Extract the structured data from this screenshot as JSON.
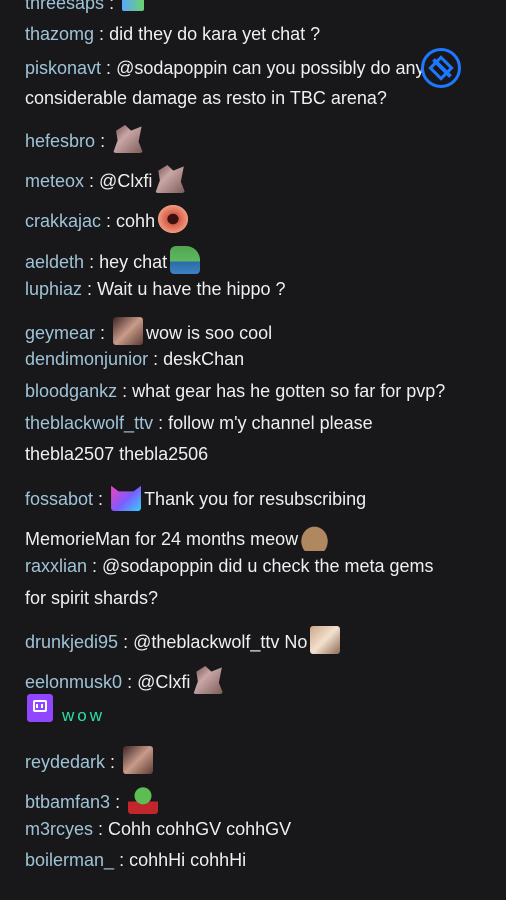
{
  "colors": {
    "background": "#18181b",
    "username": "#9fc3d6",
    "text": "#efeff1",
    "wow": "#2de0a8",
    "twitch": "#9146ff"
  },
  "messages": [
    {
      "user": "threesaps",
      "sep": " : ",
      "text": "",
      "emote": "small"
    },
    {
      "user": "thazomg",
      "sep": " : ",
      "text": "did they do kara yet chat ?"
    },
    {
      "user": "piskonavt",
      "sep": " : ",
      "text": "@sodapoppin can you possibly do any"
    },
    {
      "user": "",
      "sep": "",
      "text": "considerable damage as resto in TBC arena?"
    },
    {
      "user": "hefesbro",
      "sep": " : ",
      "text": "",
      "emote": "dog"
    },
    {
      "user": "meteox",
      "sep": " : ",
      "text": "@Clxfi",
      "emote": "dog"
    },
    {
      "user": "crakkajac",
      "sep": " : ",
      "text": "cohh",
      "emote": "lips"
    },
    {
      "user": "aeldeth",
      "sep": " : ",
      "text": "hey chat",
      "emote": "frog"
    },
    {
      "user": "luphiaz",
      "sep": " : ",
      "text": "Wait u have the hippo ?"
    },
    {
      "user": "geymear",
      "sep": " : ",
      "text": "wow is soo cool",
      "emote_before": "face"
    },
    {
      "user": "dendimonjunior",
      "sep": " : ",
      "text": "deskChan"
    },
    {
      "user": "bloodgankz",
      "sep": " : ",
      "text": "what gear has he gotten so far for pvp?"
    },
    {
      "user": "theblackwolf_ttv",
      "sep": " : ",
      "text": "follow m'y channel please"
    },
    {
      "user": "",
      "sep": "",
      "text": "thebla2507 thebla2506"
    },
    {
      "user": "fossabot",
      "sep": " : ",
      "text": "Thank you for resubscribing",
      "emote_before": "cat"
    },
    {
      "user": "",
      "sep": "",
      "text": "MemorieMan for 24 months meow",
      "emote": "rat"
    },
    {
      "user": "raxxlian",
      "sep": " : ",
      "text": "@sodapoppin did u check the meta gems"
    },
    {
      "user": "",
      "sep": "",
      "text": "for spirit shards?"
    },
    {
      "user": "drunkjedi95",
      "sep": " : ",
      "text": "@theblackwolf_ttv No",
      "emote": "man"
    },
    {
      "user": "eelonmusk0",
      "sep": " : ",
      "text": "@Clxfi",
      "emote": "dog"
    },
    {
      "user": "reydedark",
      "sep": " : ",
      "text": "",
      "emote": "face"
    },
    {
      "user": "btbamfan3",
      "sep": " : ",
      "text": "",
      "emote": "pepe"
    },
    {
      "user": "m3rcyes",
      "sep": " : ",
      "text": "Cohh cohhGV cohhGV"
    },
    {
      "user": "boilerman_",
      "sep": " : ",
      "text": "cohhHi cohhHi"
    }
  ],
  "wow_text": "wow"
}
